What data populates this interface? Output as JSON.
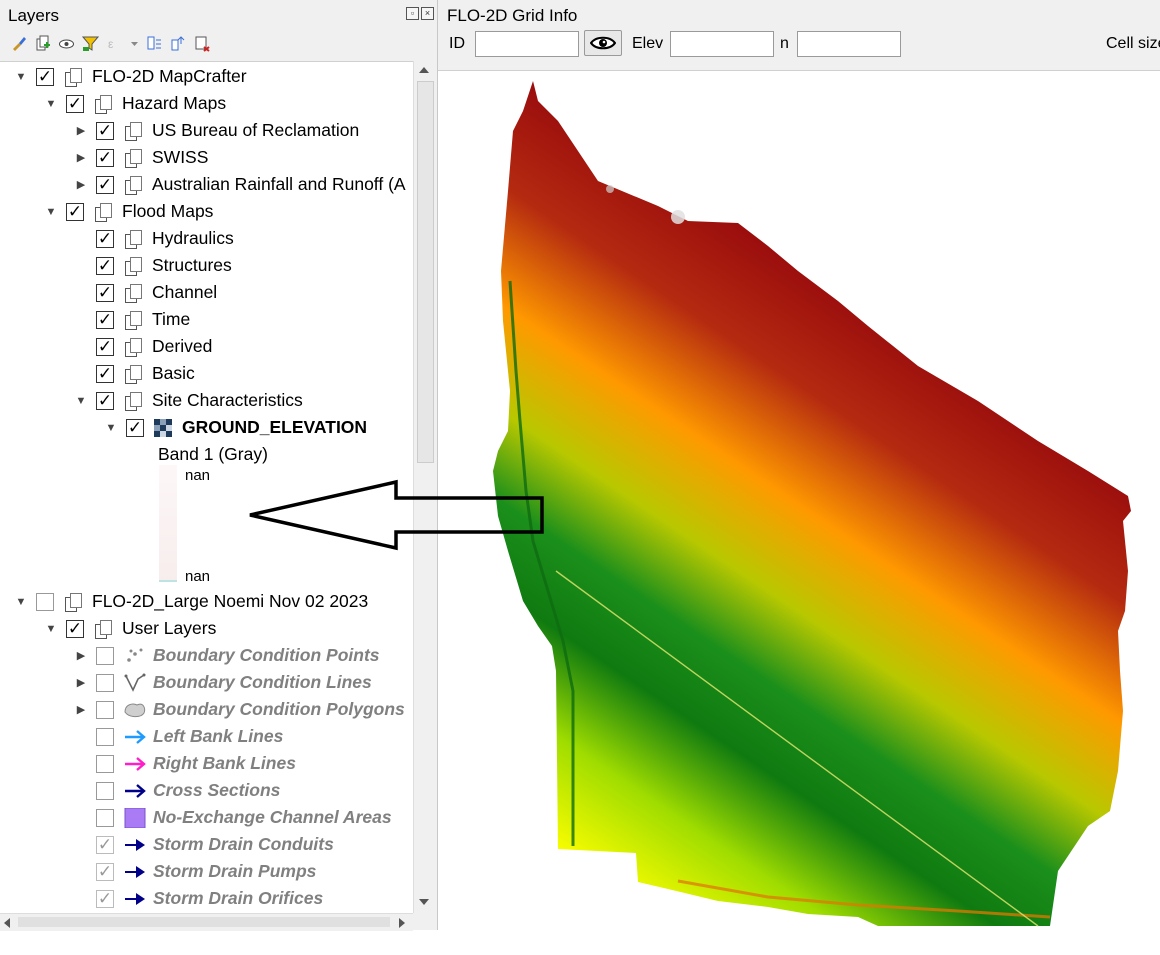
{
  "layers_panel": {
    "title": "Layers",
    "tree": [
      {
        "label": "FLO-2D MapCrafter",
        "checked": true,
        "expanded": true
      },
      {
        "label": "Hazard Maps",
        "checked": true,
        "expanded": true
      },
      {
        "label": "US Bureau of Reclamation",
        "checked": true,
        "expanded": false
      },
      {
        "label": "SWISS",
        "checked": true,
        "expanded": false
      },
      {
        "label": "Australian Rainfall and Runoff (A",
        "checked": true,
        "expanded": false
      },
      {
        "label": "Flood Maps",
        "checked": true,
        "expanded": true
      },
      {
        "label": "Hydraulics",
        "checked": true
      },
      {
        "label": "Structures",
        "checked": true
      },
      {
        "label": "Channel",
        "checked": true
      },
      {
        "label": "Time",
        "checked": true
      },
      {
        "label": "Derived",
        "checked": true
      },
      {
        "label": "Basic",
        "checked": true
      },
      {
        "label": "Site Characteristics",
        "checked": true,
        "expanded": true
      },
      {
        "label": "GROUND_ELEVATION",
        "checked": true,
        "expanded": true
      },
      {
        "label": "FLO-2D_Large Noemi Nov 02 2023",
        "checked": false,
        "expanded": true
      },
      {
        "label": "User Layers",
        "checked": true,
        "expanded": true
      },
      {
        "label": "Boundary Condition Points",
        "checked": false
      },
      {
        "label": "Boundary Condition Lines",
        "checked": false
      },
      {
        "label": "Boundary Condition Polygons",
        "checked": false
      },
      {
        "label": "Left Bank Lines",
        "checked": false,
        "color": "#1e9bff"
      },
      {
        "label": "Right Bank Lines",
        "checked": false,
        "color": "#ff1ec8"
      },
      {
        "label": "Cross Sections",
        "checked": false,
        "color": "#000088"
      },
      {
        "label": "No-Exchange Channel Areas",
        "checked": false,
        "color": "#a97cf5"
      },
      {
        "label": "Storm Drain Conduits",
        "checked": true,
        "color": "#000088"
      },
      {
        "label": "Storm Drain Pumps",
        "checked": true,
        "color": "#000088"
      },
      {
        "label": "Storm Drain Orifices",
        "checked": true,
        "color": "#000088"
      }
    ],
    "band_label": "Band 1 (Gray)",
    "legend_max": "nan",
    "legend_min": "nan"
  },
  "grid_info": {
    "title": "FLO-2D Grid Info",
    "id_label": "ID",
    "elev_label": "Elev",
    "n_label": "n",
    "cell_size_label": "Cell size",
    "id_value": "",
    "elev_value": "",
    "n_value": ""
  },
  "colors": {
    "elev_high": "#9a0d0d",
    "elev_mid_high": "#ff9900",
    "elev_mid": "#1b8f1b",
    "elev_low": "#ffff00"
  }
}
